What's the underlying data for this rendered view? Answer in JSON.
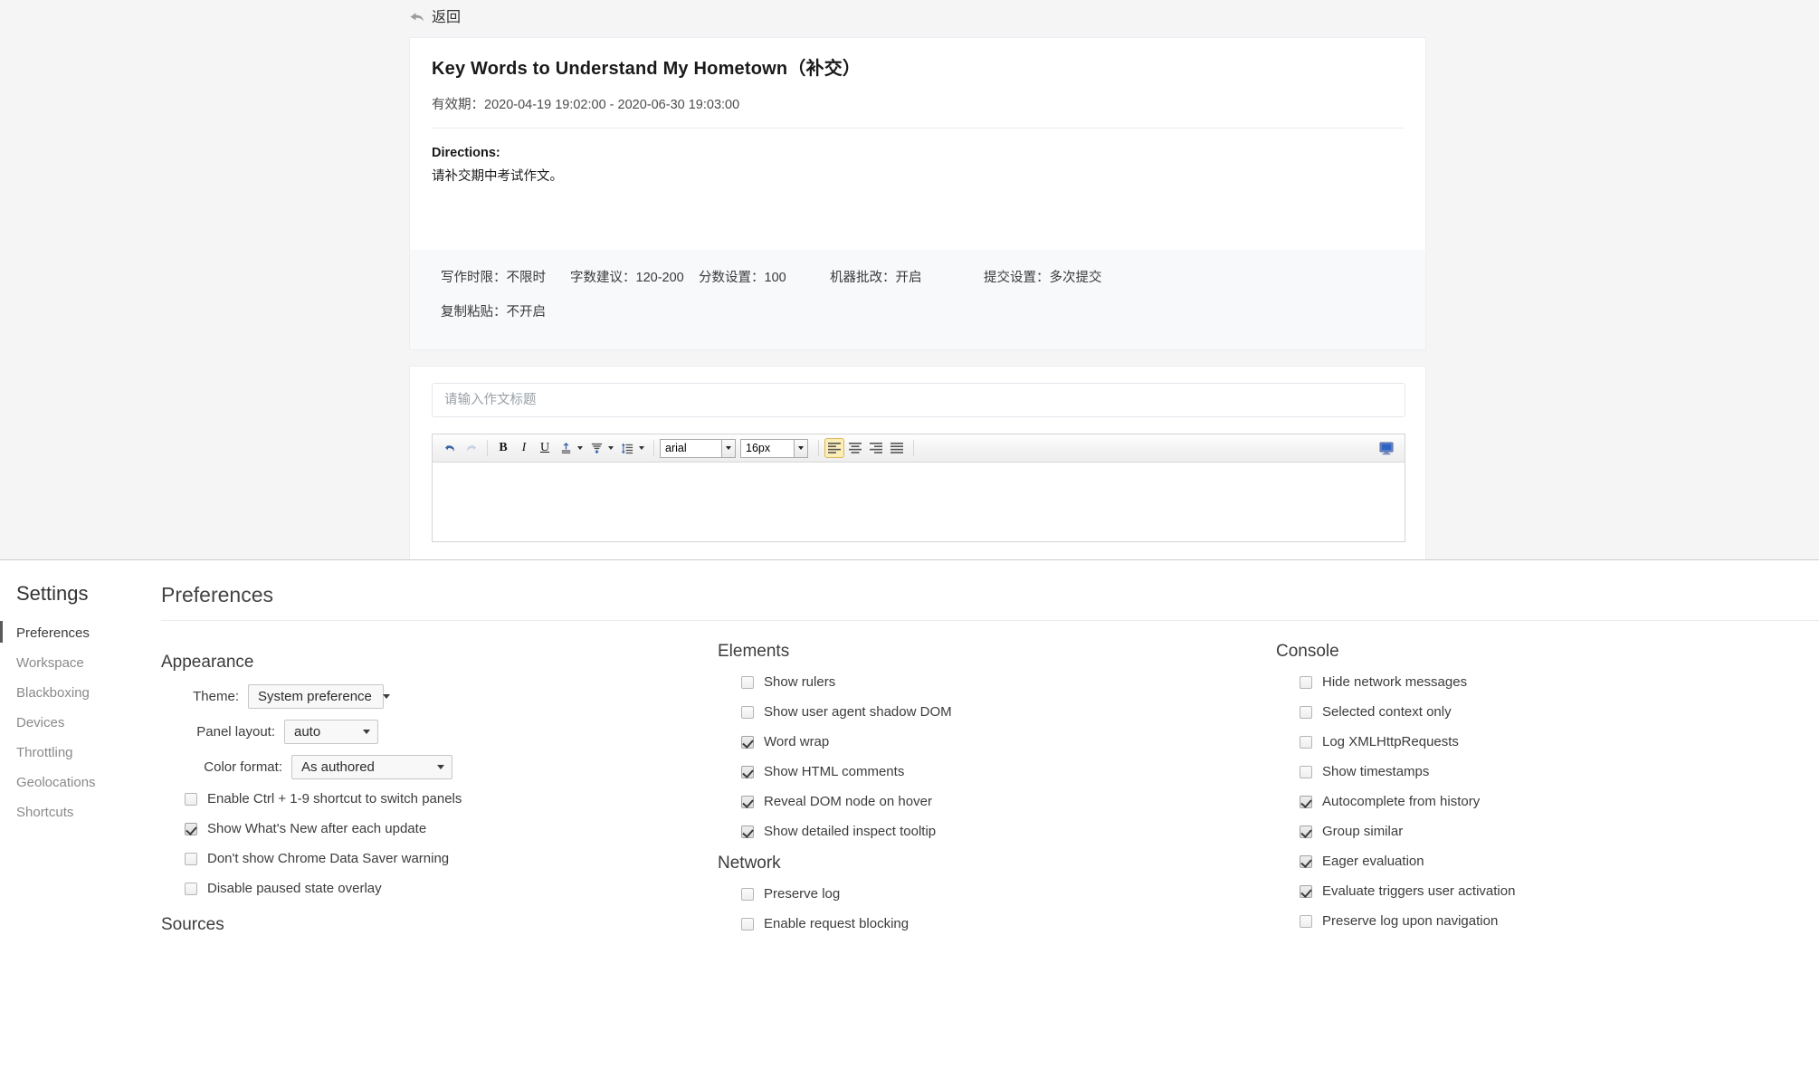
{
  "page": {
    "back_label": "返回",
    "back_icon": "back-arrow-icon",
    "assignment": {
      "title": "Key Words to Understand My Hometown（补交）",
      "valid_period_label": "有效期：",
      "valid_period_value": "2020-04-19 19:02:00 - 2020-06-30 19:03:00",
      "directions_label": "Directions:",
      "directions_body": "请补交期中考试作文。"
    },
    "meta": [
      {
        "label": "写作时限：",
        "value": "不限时"
      },
      {
        "label": "字数建议：",
        "value": "120-200"
      },
      {
        "label": "分数设置：",
        "value": "100"
      },
      {
        "label": "机器批改：",
        "value": "开启"
      },
      {
        "label": "提交设置：",
        "value": "多次提交"
      },
      {
        "label": "复制粘贴：",
        "value": "不开启"
      }
    ],
    "editor": {
      "title_placeholder": "请输入作文标题",
      "title_value": "",
      "toolbar": {
        "undo_icon": "undo-icon",
        "redo_icon": "redo-icon",
        "bold_label": "B",
        "italic_label": "I",
        "underline_label": "U",
        "font_color_icon": "font-color-icon",
        "background_color_icon": "background-color-icon",
        "line_height_icon": "line-height-icon",
        "font_family": "arial",
        "font_size": "16px",
        "align_left_icon": "align-left-icon",
        "align_center_icon": "align-center-icon",
        "align_right_icon": "align-right-icon",
        "align_justify_icon": "align-justify-icon",
        "fullscreen_icon": "fullscreen-monitor-icon"
      }
    }
  },
  "devtools": {
    "sidebar": {
      "title": "Settings",
      "items": [
        {
          "label": "Preferences",
          "selected": true
        },
        {
          "label": "Workspace",
          "selected": false
        },
        {
          "label": "Blackboxing",
          "selected": false
        },
        {
          "label": "Devices",
          "selected": false
        },
        {
          "label": "Throttling",
          "selected": false
        },
        {
          "label": "Geolocations",
          "selected": false
        },
        {
          "label": "Shortcuts",
          "selected": false
        }
      ]
    },
    "page_title": "Preferences",
    "appearance": {
      "section_title": "Appearance",
      "theme_label": "Theme:",
      "theme_value": "System preference",
      "panel_layout_label": "Panel layout:",
      "panel_layout_value": "auto",
      "color_format_label": "Color format:",
      "color_format_value": "As authored",
      "checkboxes": [
        {
          "label": "Enable Ctrl + 1-9 shortcut to switch panels",
          "checked": false
        },
        {
          "label": "Show What's New after each update",
          "checked": true
        },
        {
          "label": "Don't show Chrome Data Saver warning",
          "checked": false
        },
        {
          "label": "Disable paused state overlay",
          "checked": false
        }
      ]
    },
    "sources": {
      "section_title": "Sources"
    },
    "elements": {
      "section_title": "Elements",
      "checkboxes": [
        {
          "label": "Show rulers",
          "checked": false
        },
        {
          "label": "Show user agent shadow DOM",
          "checked": false
        },
        {
          "label": "Word wrap",
          "checked": true
        },
        {
          "label": "Show HTML comments",
          "checked": true
        },
        {
          "label": "Reveal DOM node on hover",
          "checked": true
        },
        {
          "label": "Show detailed inspect tooltip",
          "checked": true
        }
      ]
    },
    "network": {
      "section_title": "Network",
      "checkboxes": [
        {
          "label": "Preserve log",
          "checked": false
        },
        {
          "label": "Enable request blocking",
          "checked": false
        }
      ]
    },
    "console": {
      "section_title": "Console",
      "checkboxes": [
        {
          "label": "Hide network messages",
          "checked": false
        },
        {
          "label": "Selected context only",
          "checked": false
        },
        {
          "label": "Log XMLHttpRequests",
          "checked": false
        },
        {
          "label": "Show timestamps",
          "checked": false
        },
        {
          "label": "Autocomplete from history",
          "checked": true
        },
        {
          "label": "Group similar",
          "checked": true
        },
        {
          "label": "Eager evaluation",
          "checked": true
        },
        {
          "label": "Evaluate triggers user activation",
          "checked": true
        },
        {
          "label": "Preserve log upon navigation",
          "checked": false
        }
      ]
    }
  },
  "colors": {
    "page_bg": "#f5f5f5",
    "card_bg": "#ffffff",
    "meta_bg": "#f7f9fb",
    "toolbar_active": "#fdeeb8",
    "sidebar_selected_bar": "#5a5a5a",
    "editor_icon_blue": "#4a72b8"
  }
}
